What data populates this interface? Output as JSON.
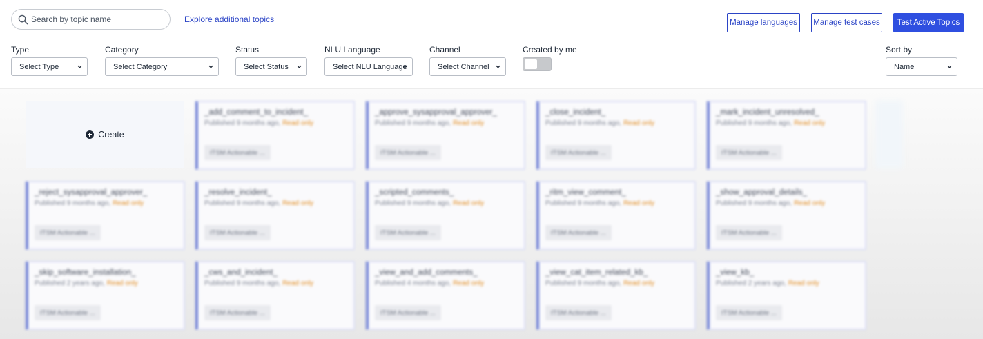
{
  "search": {
    "placeholder": "Search by topic name"
  },
  "explore_link": "Explore additional topics",
  "actions": {
    "manage_languages": "Manage languages",
    "manage_test_cases": "Manage test cases",
    "test_active_topics": "Test Active Topics"
  },
  "filters": {
    "type": {
      "label": "Type",
      "value": "Select Type"
    },
    "category": {
      "label": "Category",
      "value": "Select Category"
    },
    "status": {
      "label": "Status",
      "value": "Select Status"
    },
    "nlu_language": {
      "label": "NLU Language",
      "value": "Select NLU Language"
    },
    "channel": {
      "label": "Channel",
      "value": "Select Channel"
    },
    "created_by_me": {
      "label": "Created by me",
      "on": false
    },
    "sort_by": {
      "label": "Sort by",
      "value": "Name"
    }
  },
  "create_label": "Create",
  "topics": [
    {
      "name": "_add_comment_to_incident_",
      "published": "Published 9 months ago,",
      "status": "Read only",
      "tag": "ITSM Actionable ..."
    },
    {
      "name": "_approve_sysapproval_approver_",
      "published": "Published 9 months ago,",
      "status": "Read only",
      "tag": "ITSM Actionable ..."
    },
    {
      "name": "_close_incident_",
      "published": "Published 9 months ago,",
      "status": "Read only",
      "tag": "ITSM Actionable ..."
    },
    {
      "name": "_mark_incident_unresolved_",
      "published": "Published 9 months ago,",
      "status": "Read only",
      "tag": "ITSM Actionable ..."
    },
    {
      "name": "_reject_sysapproval_approver_",
      "published": "Published 9 months ago,",
      "status": "Read only",
      "tag": "ITSM Actionable ..."
    },
    {
      "name": "_resolve_incident_",
      "published": "Published 9 months ago,",
      "status": "Read only",
      "tag": "ITSM Actionable ..."
    },
    {
      "name": "_scripted_comments_",
      "published": "Published 9 months ago,",
      "status": "Read only",
      "tag": "ITSM Actionable ..."
    },
    {
      "name": "_ritm_view_comment_",
      "published": "Published 9 months ago,",
      "status": "Read only",
      "tag": "ITSM Actionable ..."
    },
    {
      "name": "_show_approval_details_",
      "published": "Published 9 months ago,",
      "status": "Read only",
      "tag": "ITSM Actionable ..."
    },
    {
      "name": "_skip_software_installation_",
      "published": "Published 2 years ago,",
      "status": "Read only",
      "tag": "ITSM Actionable ..."
    },
    {
      "name": "_cws_and_incident_",
      "published": "Published 9 months ago,",
      "status": "Read only",
      "tag": "ITSM Actionable ..."
    },
    {
      "name": "_view_and_add_comments_",
      "published": "Published 4 months ago,",
      "status": "Read only",
      "tag": "ITSM Actionable ..."
    },
    {
      "name": "_view_cat_item_related_kb_",
      "published": "Published 9 months ago,",
      "status": "Read only",
      "tag": "ITSM Actionable ..."
    },
    {
      "name": "_view_kb_",
      "published": "Published 2 years ago,",
      "status": "Read only",
      "tag": "ITSM Actionable ..."
    }
  ]
}
